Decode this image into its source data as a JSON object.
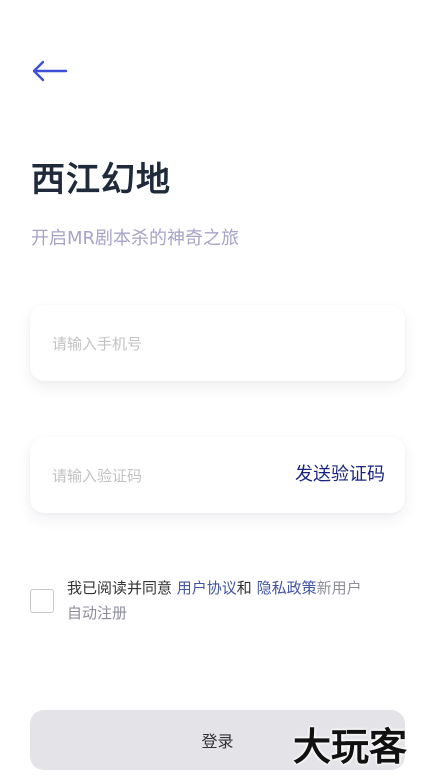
{
  "header": {
    "back_icon": "arrow-left-icon",
    "title": "西江幻地",
    "subtitle": "开启MR剧本杀的神奇之旅"
  },
  "form": {
    "phone_placeholder": "请输入手机号",
    "phone_value": "",
    "code_placeholder": "请输入验证码",
    "code_value": "",
    "send_code_label": "发送验证码"
  },
  "agreement": {
    "checked": false,
    "prefix": "我已阅读并同意 ",
    "user_agreement": "用户协议",
    "and": "和 ",
    "privacy_policy": "隐私政策",
    "suffix_muted": "新用户",
    "suffix": "自动注册"
  },
  "login_label": "登录",
  "watermark_text": "大玩客",
  "colors": {
    "title": "#1f2a3a",
    "subtitle": "#a7a3c9",
    "send_code": "#1a2580",
    "link": "#4154a4",
    "login_bg": "#e3e3e8",
    "back_arrow": "#3d4fd6"
  }
}
